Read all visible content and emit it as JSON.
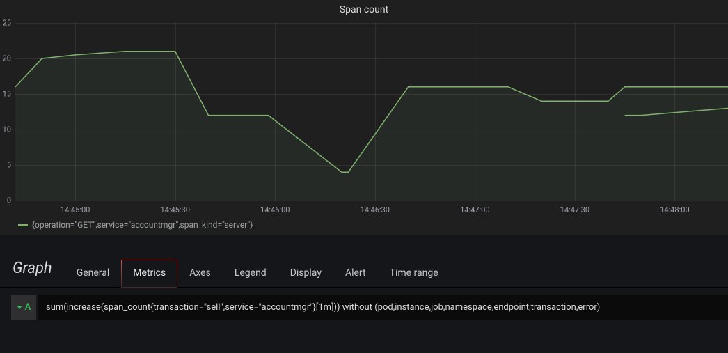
{
  "chart_data": {
    "type": "line",
    "title": "Span count",
    "xlabel": "",
    "ylabel": "",
    "ylim": [
      0,
      25
    ],
    "y_ticks": [
      0,
      5,
      10,
      15,
      20,
      25
    ],
    "x_ticks": [
      "14:45:00",
      "14:45:30",
      "14:46:00",
      "14:46:30",
      "14:47:00",
      "14:47:30",
      "14:48:00"
    ],
    "x_range_seconds": [
      -18,
      196
    ],
    "series": [
      {
        "name": "{operation=\"GET\",service=\"accountmgr\",span_kind=\"server\"}",
        "color": "#7eb26d",
        "x_seconds": [
          -18,
          -10,
          0,
          15,
          30,
          40,
          58,
          80,
          82,
          100,
          108,
          130,
          140,
          160,
          165,
          196
        ],
        "y": [
          16,
          20,
          20.5,
          21,
          21,
          12,
          12,
          4,
          4,
          16,
          16,
          16,
          14,
          14,
          16,
          16
        ]
      },
      {
        "name": null,
        "color": "#7eb26d",
        "x_seconds": [
          165,
          170,
          196
        ],
        "y": [
          12,
          12,
          13
        ]
      }
    ]
  },
  "legend": {
    "label": "{operation=\"GET\",service=\"accountmgr\",span_kind=\"server\"}"
  },
  "editor": {
    "title": "Graph",
    "tabs": [
      {
        "label": "General",
        "active": false
      },
      {
        "label": "Metrics",
        "active": true
      },
      {
        "label": "Axes",
        "active": false
      },
      {
        "label": "Legend",
        "active": false
      },
      {
        "label": "Display",
        "active": false
      },
      {
        "label": "Alert",
        "active": false
      },
      {
        "label": "Time range",
        "active": false
      }
    ]
  },
  "query": {
    "letter": "A",
    "expr": "sum(increase(span_count{transaction=\"sell\",service=\"accountmgr\"}[1m])) without (pod,instance,job,namespace,endpoint,transaction,error)"
  }
}
